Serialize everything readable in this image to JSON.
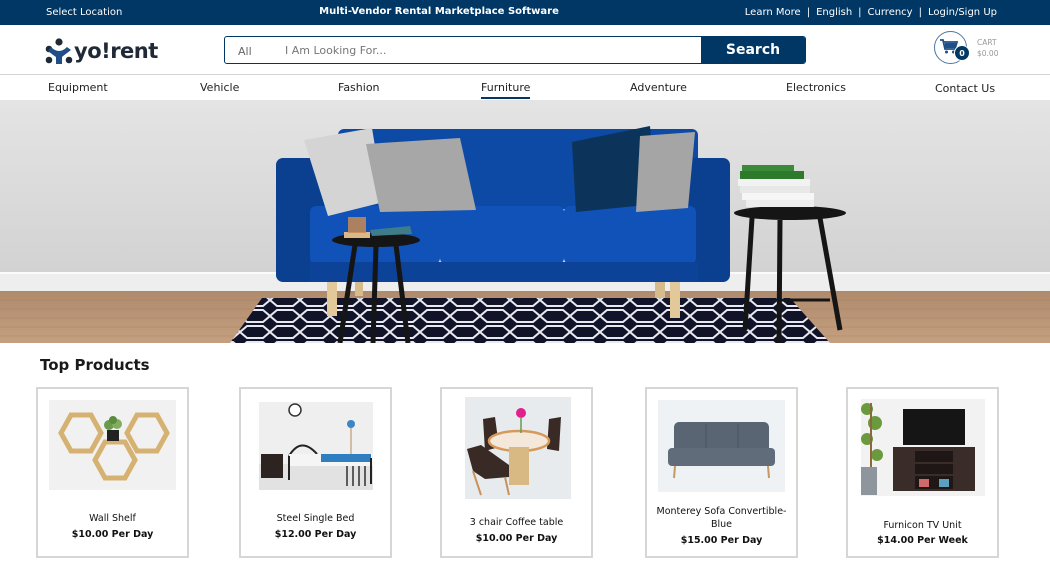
{
  "topbar": {
    "location_label": "Select Location",
    "tagline": "Multi-Vendor Rental Marketplace Software",
    "links": [
      "Learn More",
      "English",
      "Currency",
      "Login/Sign Up"
    ],
    "separator": "|"
  },
  "header": {
    "logo_text": "yo!rent",
    "search": {
      "category": "All",
      "placeholder": "I Am Looking For...",
      "value": "",
      "button_label": "Search"
    },
    "cart": {
      "label": "CART",
      "amount": "$0.00",
      "count": "0"
    }
  },
  "nav": {
    "items": [
      {
        "label": "Equipment"
      },
      {
        "label": "Vehicle"
      },
      {
        "label": "Fashion"
      },
      {
        "label": "Furniture",
        "active": true
      },
      {
        "label": "Adventure"
      },
      {
        "label": "Electronics"
      },
      {
        "label": "Contact Us"
      }
    ]
  },
  "hero": {
    "image_description": "Blue sofa with pillows, two black side tables and patterned rug"
  },
  "products": {
    "title": "Top Products",
    "items": [
      {
        "name": "Wall Shelf",
        "price": "$10.00 Per Day"
      },
      {
        "name": "Steel Single Bed",
        "price": "$12.00 Per Day"
      },
      {
        "name": "3 chair Coffee table",
        "price": "$10.00 Per Day"
      },
      {
        "name": "Monterey Sofa Convertible-Blue",
        "price": "$15.00 Per Day"
      },
      {
        "name": "Furnicon TV Unit",
        "price": "$14.00 Per Week"
      }
    ]
  },
  "colors": {
    "brand": "#003764",
    "sofa_blue": "#0d47a1",
    "card_border": "#d6d6d6"
  }
}
